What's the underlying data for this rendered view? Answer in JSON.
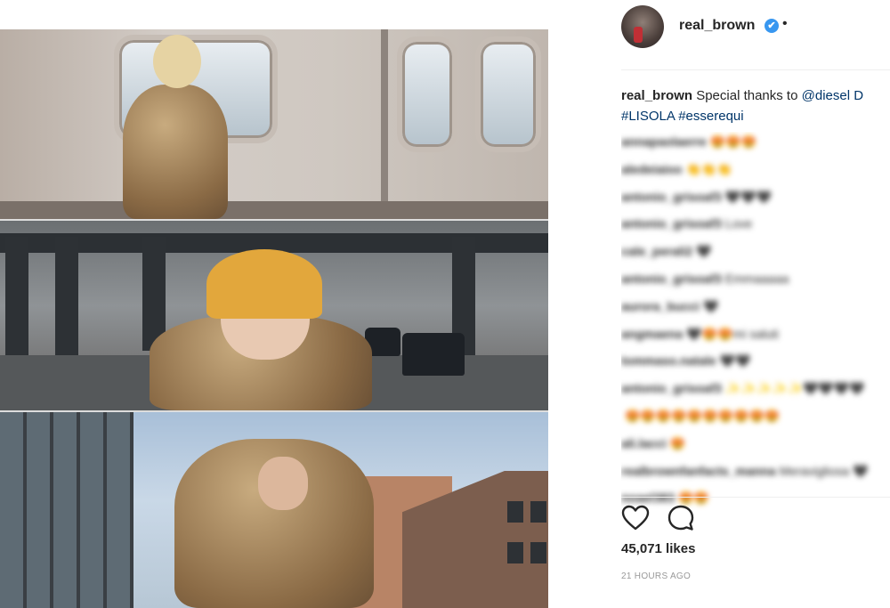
{
  "post": {
    "username": "real_brown",
    "verified_glyph": "✔",
    "header_dot": "•",
    "caption_user": "real_brown",
    "caption_text": "Special thanks to",
    "caption_mention": "@diesel D",
    "caption_tags": "#LISOLA #esserequi",
    "likes": "45,071 likes",
    "time": "21 HOURS AGO"
  },
  "comments": [
    {
      "user": "annapaolaerre",
      "text": "😍😍😍"
    },
    {
      "user": "aledeiaioo",
      "text": "👏👏👏"
    },
    {
      "user": "antonio_grisoaf3",
      "text": "🖤🖤🖤"
    },
    {
      "user": "antonio_grisoaf3",
      "text": "Love"
    },
    {
      "user": "cale_perali2",
      "text": "🖤"
    },
    {
      "user": "antonio_grisoaf3",
      "text": "Emmaaaaa"
    },
    {
      "user": "aurora_bucci",
      "text": "🖤"
    },
    {
      "user": "angmaena",
      "text": "🖤😍😍mi saluti"
    },
    {
      "user": "tommaso.natale",
      "text": "🖤🖤"
    },
    {
      "user": "antonio_grisoaf3",
      "text": "✨✨✨✨✨🖤🖤🖤🖤"
    },
    {
      "user": "",
      "text": "😍😍😍😍😍😍😍😍😍😍"
    },
    {
      "user": "ali.lacci",
      "text": "😍"
    },
    {
      "user": "realbrownfanfacts_manna",
      "text": "Meravigliosa 🖤"
    },
    {
      "user": "noael383",
      "text": "😍😍"
    }
  ],
  "icons": {
    "like": "heart-outline-icon",
    "comment": "comment-bubble-icon",
    "verified": "verified-badge-icon"
  },
  "colors": {
    "link": "#003569",
    "verified": "#3897f0",
    "muted": "#999999",
    "text": "#262626"
  }
}
